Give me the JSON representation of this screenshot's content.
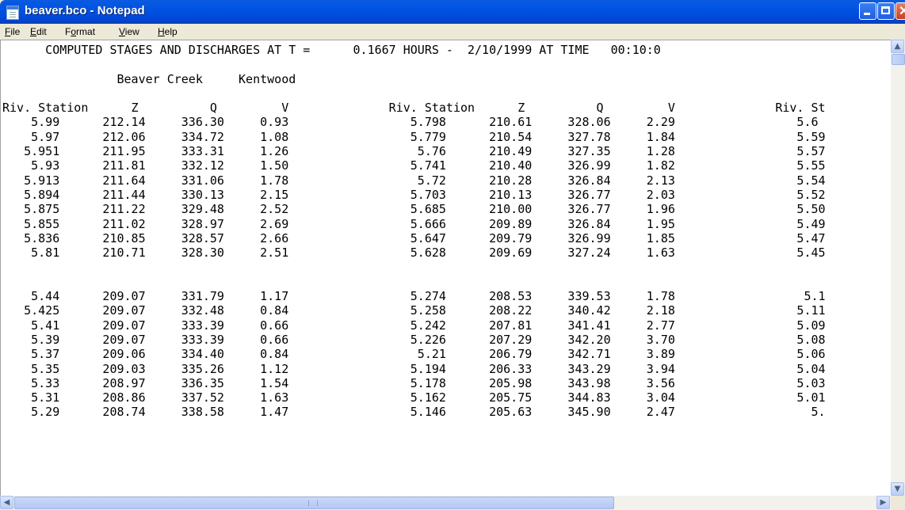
{
  "window": {
    "title": "beaver.bco - Notepad"
  },
  "menu": {
    "items": [
      {
        "label": "File",
        "u": "F",
        "rest": "ile"
      },
      {
        "label": "Edit",
        "u": "E",
        "rest": "dit"
      },
      {
        "label": "Format",
        "u": "o",
        "pre": "F",
        "rest": "rmat"
      },
      {
        "label": "View",
        "u": "V",
        "rest": "iew"
      },
      {
        "label": "Help",
        "u": "H",
        "rest": "elp"
      }
    ]
  },
  "icons": {
    "app": "notepad-icon",
    "minimize": "minimize-icon",
    "maximize": "maximize-icon",
    "close": "close-icon",
    "scroll_up": "arrow-up-icon",
    "scroll_down": "arrow-down-icon",
    "scroll_left": "arrow-left-icon",
    "scroll_right": "arrow-right-icon"
  },
  "document": {
    "lines": [
      "      COMPUTED STAGES AND DISCHARGES AT T =      0.1667 HOURS -  2/10/1999 AT TIME   00:10:0",
      "",
      "                Beaver Creek     Kentwood",
      "",
      "Riv. Station      Z          Q         V              Riv. Station      Z          Q         V              Riv. St",
      "    5.99      212.14     336.30     0.93                 5.798      210.61     328.06     2.29                 5.6",
      "    5.97      212.06     334.72     1.08                 5.779      210.54     327.78     1.84                 5.59",
      "   5.951      211.95     333.31     1.26                  5.76      210.49     327.35     1.28                 5.57",
      "    5.93      211.81     332.12     1.50                 5.741      210.40     326.99     1.82                 5.55",
      "   5.913      211.64     331.06     1.78                  5.72      210.28     326.84     2.13                 5.54",
      "   5.894      211.44     330.13     2.15                 5.703      210.13     326.77     2.03                 5.52",
      "   5.875      211.22     329.48     2.52                 5.685      210.00     326.77     1.96                 5.50",
      "   5.855      211.02     328.97     2.69                 5.666      209.89     326.84     1.95                 5.49",
      "   5.836      210.85     328.57     2.66                 5.647      209.79     326.99     1.85                 5.47",
      "    5.81      210.71     328.30     2.51                 5.628      209.69     327.24     1.63                 5.45",
      "",
      "",
      "    5.44      209.07     331.79     1.17                 5.274      208.53     339.53     1.78                  5.1",
      "   5.425      209.07     332.48     0.84                 5.258      208.22     340.42     2.18                 5.11",
      "    5.41      209.07     333.39     0.66                 5.242      207.81     341.41     2.77                 5.09",
      "    5.39      209.07     333.39     0.66                 5.226      207.29     342.20     3.70                 5.08",
      "    5.37      209.06     334.40     0.84                  5.21      206.79     342.71     3.89                 5.06",
      "    5.35      209.03     335.26     1.12                 5.194      206.33     343.29     3.94                 5.04",
      "    5.33      208.97     336.35     1.54                 5.178      205.98     343.98     3.56                 5.03",
      "    5.31      208.86     337.52     1.63                 5.162      205.75     344.83     3.04                 5.01",
      "    5.29      208.74     338.58     1.47                 5.146      205.63     345.90     2.47                   5."
    ]
  }
}
